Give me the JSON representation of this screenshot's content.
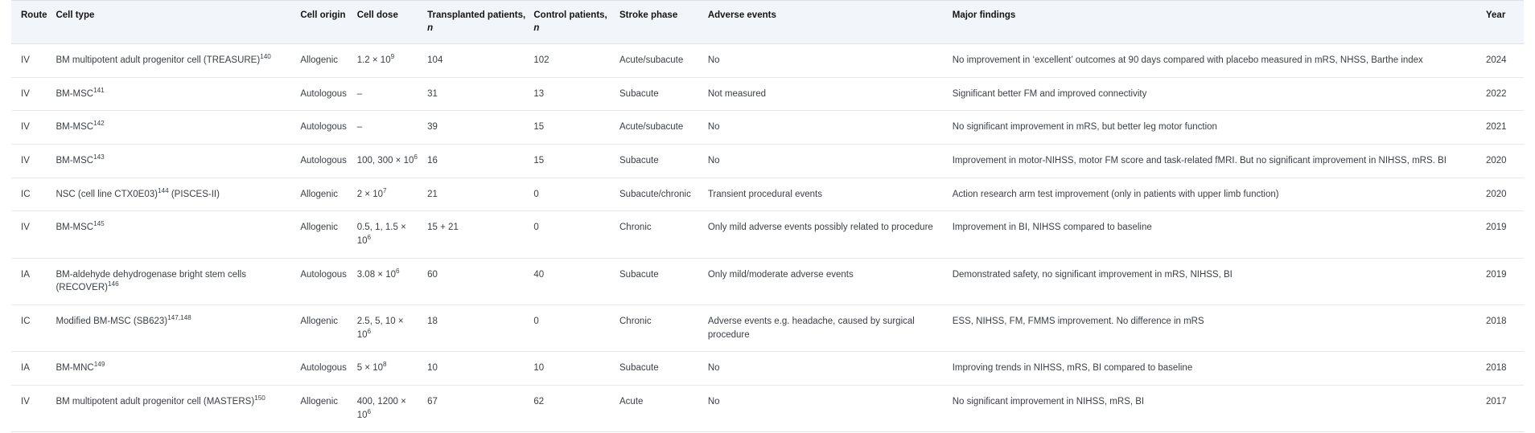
{
  "table": {
    "columns": [
      {
        "key": "route",
        "label": "Route"
      },
      {
        "key": "cell_type",
        "label": "Cell type"
      },
      {
        "key": "origin",
        "label": "Cell origin"
      },
      {
        "key": "dose",
        "label": "Cell dose"
      },
      {
        "key": "trans",
        "label": "Transplanted patients,",
        "sub": "n"
      },
      {
        "key": "control",
        "label": "Control patients,",
        "sub": "n"
      },
      {
        "key": "phase",
        "label": "Stroke phase"
      },
      {
        "key": "adverse",
        "label": "Adverse events"
      },
      {
        "key": "findings",
        "label": "Major findings"
      },
      {
        "key": "year",
        "label": "Year"
      }
    ],
    "rows": [
      {
        "route": "IV",
        "cell_type": "BM multipotent adult progenitor cell (TREASURE)",
        "cell_type_ref": "140",
        "origin": "Allogenic",
        "dose_base": "1.2 × 10",
        "dose_exp": "9",
        "trans": "104",
        "control": "102",
        "phase": "Acute/subacute",
        "adverse": "No",
        "findings": "No improvement in ‘excellent’ outcomes at 90 days compared with placebo measured in mRS, NHSS, Barthe index",
        "year": "2024"
      },
      {
        "route": "IV",
        "cell_type": "BM-MSC",
        "cell_type_ref": "141",
        "origin": "Autologous",
        "dose_base": "–",
        "dose_exp": "",
        "trans": "31",
        "control": "13",
        "phase": "Subacute",
        "adverse": "Not measured",
        "findings": "Significant better FM and improved connectivity",
        "year": "2022"
      },
      {
        "route": "IV",
        "cell_type": "BM-MSC",
        "cell_type_ref": "142",
        "origin": "Autologous",
        "dose_base": "–",
        "dose_exp": "",
        "trans": "39",
        "control": "15",
        "phase": "Acute/subacute",
        "adverse": "No",
        "findings": "No significant improvement in mRS, but better leg motor function",
        "year": "2021"
      },
      {
        "route": "IV",
        "cell_type": "BM-MSC",
        "cell_type_ref": "143",
        "origin": "Autologous",
        "dose_base": "100, 300 × 10",
        "dose_exp": "6",
        "trans": "16",
        "control": "15",
        "phase": "Subacute",
        "adverse": "No",
        "findings": "Improvement in motor-NIHSS, motor FM score and task-related fMRI. But no significant improvement in NIHSS, mRS. BI",
        "year": "2020"
      },
      {
        "route": "IC",
        "cell_type": "NSC (cell line CTX0E03)",
        "cell_type_ref": "144",
        "cell_type_suffix": " (PISCES-II)",
        "origin": "Allogenic",
        "dose_base": "2 × 10",
        "dose_exp": "7",
        "trans": "21",
        "control": "0",
        "phase": "Subacute/chronic",
        "adverse": "Transient procedural events",
        "findings": "Action research arm test improvement (only in patients with upper limb function)",
        "year": "2020"
      },
      {
        "route": "IV",
        "cell_type": "BM-MSC",
        "cell_type_ref": "145",
        "origin": "Allogenic",
        "dose_base": "0.5, 1, 1.5 × 10",
        "dose_exp": "6",
        "trans": "15 + 21",
        "control": "0",
        "phase": "Chronic",
        "adverse": "Only mild adverse events possibly related to procedure",
        "findings": "Improvement in BI, NIHSS compared to baseline",
        "year": "2019"
      },
      {
        "route": "IA",
        "cell_type": "BM-aldehyde dehydrogenase bright stem cells (RECOVER)",
        "cell_type_ref": "146",
        "origin": "Autologous",
        "dose_base": "3.08 × 10",
        "dose_exp": "6",
        "trans": "60",
        "control": "40",
        "phase": "Subacute",
        "adverse": "Only mild/moderate adverse events",
        "findings": "Demonstrated safety, no significant improvement in mRS, NIHSS, BI",
        "year": "2019"
      },
      {
        "route": "IC",
        "cell_type": "Modified BM-MSC (SB623)",
        "cell_type_ref": "147,148",
        "origin": "Allogenic",
        "dose_base": "2.5, 5, 10 × 10",
        "dose_exp": "6",
        "trans": "18",
        "control": "0",
        "phase": "Chronic",
        "adverse": "Adverse events e.g. headache, caused by surgical procedure",
        "findings": "ESS, NIHSS, FM, FMMS improvement. No difference in mRS",
        "year": "2018"
      },
      {
        "route": "IA",
        "cell_type": "BM-MNC",
        "cell_type_ref": "149",
        "origin": "Autologous",
        "dose_base": "5 × 10",
        "dose_exp": "8",
        "trans": "10",
        "control": "10",
        "phase": "Subacute",
        "adverse": "No",
        "findings": "Improving trends in NIHSS, mRS, BI compared to baseline",
        "year": "2018"
      },
      {
        "route": "IV",
        "cell_type": "BM multipotent adult progenitor cell (MASTERS)",
        "cell_type_ref": "150",
        "origin": "Allogenic",
        "dose_base": "400, 1200 × 10",
        "dose_exp": "6",
        "trans": "67",
        "control": "62",
        "phase": "Acute",
        "adverse": "No",
        "findings": "No significant improvement in NIHSS, mRS, BI",
        "year": "2017"
      }
    ]
  },
  "colors": {
    "header_background": "#f2f5fa",
    "border": "#dfe3e8",
    "row_border": "#e6e8ec",
    "text": "#3a3f45",
    "header_text": "#141414"
  }
}
